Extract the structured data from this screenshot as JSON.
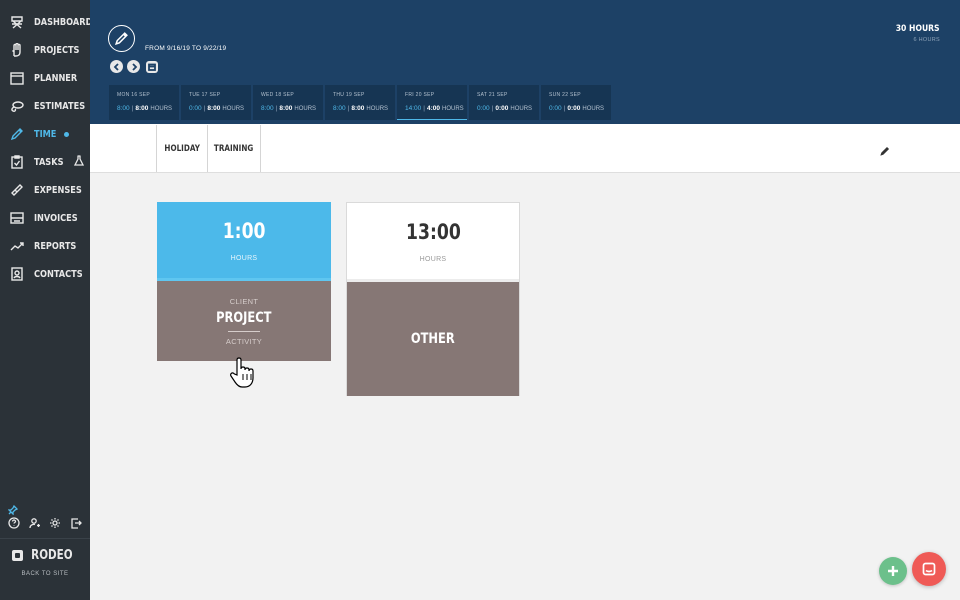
{
  "sidebar": {
    "items": [
      {
        "label": "DASHBOARD",
        "icon": "director-chair-icon"
      },
      {
        "label": "PROJECTS",
        "icon": "hand-icon"
      },
      {
        "label": "PLANNER",
        "icon": "calendar-icon"
      },
      {
        "label": "ESTIMATES",
        "icon": "lasso-icon"
      },
      {
        "label": "TIME",
        "icon": "time-icon",
        "active": true
      },
      {
        "label": "TASKS",
        "icon": "clipboard-icon"
      },
      {
        "label": "EXPENSES",
        "icon": "ticket-icon"
      },
      {
        "label": "INVOICES",
        "icon": "invoice-icon"
      },
      {
        "label": "REPORTS",
        "icon": "trend-icon"
      },
      {
        "label": "CONTACTS",
        "icon": "contacts-icon"
      }
    ],
    "brand": "RODEO",
    "back_to_site": "BACK TO SITE"
  },
  "header": {
    "range": "FROM 9/16/19 TO 9/22/19",
    "total_hours": "30 HOURS",
    "sub_hours": "6 HOURS",
    "days": [
      {
        "name": "MON 16 SEP",
        "v1": "8:00",
        "v2": "8:00",
        "unit": "HOURS"
      },
      {
        "name": "TUE 17 SEP",
        "v1": "0:00",
        "v2": "8:00",
        "unit": "HOURS"
      },
      {
        "name": "WED 18 SEP",
        "v1": "8:00",
        "v2": "8:00",
        "unit": "HOURS"
      },
      {
        "name": "THU 19 SEP",
        "v1": "8:00",
        "v2": "8:00",
        "unit": "HOURS"
      },
      {
        "name": "FRI 20 SEP",
        "v1": "14:00",
        "v2": "4:00",
        "unit": "HOURS",
        "active": true
      },
      {
        "name": "SAT 21 SEP",
        "v1": "0:00",
        "v2": "0:00",
        "unit": "HOURS"
      },
      {
        "name": "SUN 22 SEP",
        "v1": "0:00",
        "v2": "0:00",
        "unit": "HOURS"
      }
    ]
  },
  "tabs": [
    {
      "label": "HOLIDAY"
    },
    {
      "label": "TRAINING"
    }
  ],
  "cards": [
    {
      "amount": "1:00",
      "hours_label": "HOURS",
      "client": "CLIENT",
      "project": "PROJECT",
      "activity": "ACTIVITY",
      "color": "#4cb9ea"
    },
    {
      "amount": "13:00",
      "hours_label": "HOURS",
      "label": "OTHER",
      "color": "#867775"
    }
  ],
  "colors": {
    "sidebar": "#2b3238",
    "header": "#1d4166",
    "accent": "#4fb8e8",
    "card_bottom": "#867775",
    "fab_add": "#6cc08b",
    "fab_chat": "#ef5a56"
  }
}
